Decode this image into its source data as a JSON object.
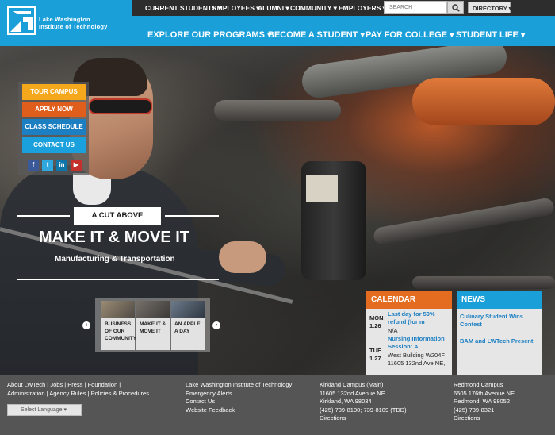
{
  "logo": {
    "line1": "Lake Washington",
    "line2": "Institute of Technology"
  },
  "topnav": {
    "items": [
      "CURRENT STUDENTS ▾",
      "EMPLOYEES ▾",
      "ALUMNI ▾",
      "COMMUNITY ▾",
      "EMPLOYERS ▾"
    ],
    "search_placeholder": "SEARCH",
    "directory": "DIRECTORY ▾"
  },
  "mainnav": {
    "items": [
      "EXPLORE OUR PROGRAMS ▾",
      "BECOME A STUDENT ▾",
      "PAY FOR COLLEGE ▾",
      "STUDENT LIFE ▾"
    ]
  },
  "sidebar": {
    "buttons": [
      "TOUR CAMPUS",
      "APPLY NOW",
      "CLASS SCHEDULE",
      "CONTACT US"
    ],
    "social": [
      "f",
      "t",
      "in",
      "▶"
    ]
  },
  "hero": {
    "tag": "A CUT ABOVE",
    "headline": "MAKE IT & MOVE IT",
    "subhead": "Manufacturing & Transportation"
  },
  "carousel": {
    "items": [
      "BUSINESS OF OUR COMMUNITY",
      "MAKE IT & MOVE IT",
      "AN APPLE A DAY"
    ],
    "prev": "‹",
    "next": "›"
  },
  "calendar": {
    "title": "CALENDAR",
    "events": [
      {
        "dow": "MON",
        "date": "1.26",
        "title_lines": [
          "Last day for 50%",
          "refund (for m"
        ],
        "detail_lines": [
          "N/A"
        ]
      },
      {
        "dow": "TUE",
        "date": "1.27",
        "title_lines": [
          "Nursing Information",
          "Session: A"
        ],
        "detail_lines": [
          "West Building W204F",
          "11605 132nd Ave NE,"
        ]
      }
    ]
  },
  "news": {
    "title": "NEWS",
    "items": [
      "Culinary Student Wins Contest",
      "BAM and LWTech Present"
    ]
  },
  "footer": {
    "col1": [
      "About LWTech | Jobs | Press | Foundation |",
      "Administration | Agency Rules | Policies & Procedures"
    ],
    "language": "Select Language ▾",
    "col2": [
      "Lake Washington Institute of Technology",
      "Emergency Alerts",
      "Contact Us",
      "Website Feedback"
    ],
    "col3": [
      "Kirkland Campus (Main)",
      "11605 132nd Avenue NE",
      "Kirkland, WA 98034",
      "(425) 739-8100; 739-8109 (TDD)",
      "Directions"
    ],
    "col4": [
      "Redmond Campus",
      "6505 176th Avenue NE",
      "Redmond, WA 98052",
      "(425) 739-8321",
      "Directions"
    ]
  },
  "colors": {
    "brand_blue": "#1a9fd9",
    "orange": "#e46c20",
    "yellow": "#f5a81c",
    "dark_orange": "#e05e1c",
    "blue": "#1c7fc2",
    "light_blue": "#1aa0dc"
  }
}
